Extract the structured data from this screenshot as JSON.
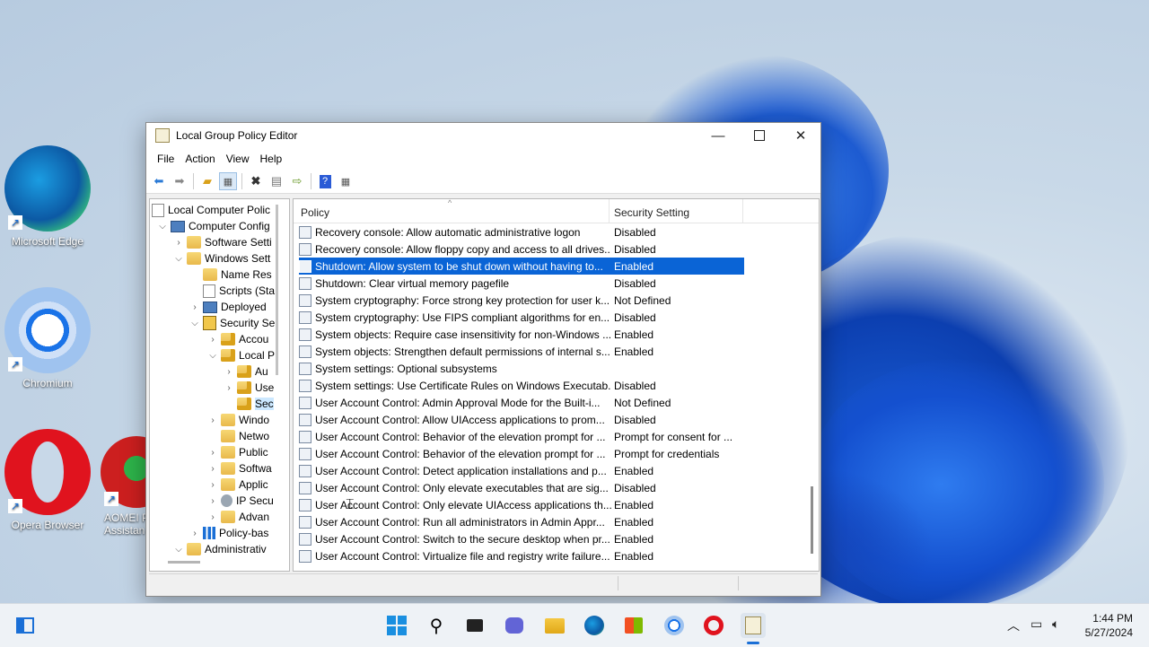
{
  "desktop": {
    "icons": [
      {
        "label": "Microsoft Edge"
      },
      {
        "label": "Chromium"
      },
      {
        "label": "Opera Browser"
      },
      {
        "label": "AOMEI P\nAssistan"
      }
    ]
  },
  "window": {
    "title": "Local Group Policy Editor",
    "menu": [
      "File",
      "Action",
      "View",
      "Help"
    ],
    "tree": [
      {
        "label": "Local Computer Polic",
        "indent": 0,
        "icon": "doc",
        "exp": ""
      },
      {
        "label": "Computer Config",
        "indent": 1,
        "icon": "pc",
        "exp": "v"
      },
      {
        "label": "Software Setti",
        "indent": 2,
        "icon": "folder",
        "exp": ">"
      },
      {
        "label": "Windows Sett",
        "indent": 2,
        "icon": "folder",
        "exp": "v"
      },
      {
        "label": "Name Res",
        "indent": 3,
        "icon": "folder",
        "exp": ""
      },
      {
        "label": "Scripts (Sta",
        "indent": 3,
        "icon": "doc",
        "exp": ""
      },
      {
        "label": "Deployed",
        "indent": 3,
        "icon": "pc",
        "exp": ">"
      },
      {
        "label": "Security Se",
        "indent": 3,
        "icon": "shield",
        "exp": "v"
      },
      {
        "label": "Accou",
        "indent": 4,
        "icon": "lockf",
        "exp": ">"
      },
      {
        "label": "Local P",
        "indent": 4,
        "icon": "lockf",
        "exp": "v"
      },
      {
        "label": "Au",
        "indent": 5,
        "icon": "lockf",
        "exp": ">"
      },
      {
        "label": "Use",
        "indent": 5,
        "icon": "lockf",
        "exp": ">"
      },
      {
        "label": "Sec",
        "indent": 5,
        "icon": "lockf",
        "exp": "",
        "selected": true
      },
      {
        "label": "Windo",
        "indent": 4,
        "icon": "folder",
        "exp": ">"
      },
      {
        "label": "Netwo",
        "indent": 4,
        "icon": "folder",
        "exp": ""
      },
      {
        "label": "Public",
        "indent": 4,
        "icon": "folder",
        "exp": ">"
      },
      {
        "label": "Softwa",
        "indent": 4,
        "icon": "folder",
        "exp": ">"
      },
      {
        "label": "Applic",
        "indent": 4,
        "icon": "folder",
        "exp": ">"
      },
      {
        "label": "IP Secu",
        "indent": 4,
        "icon": "gear",
        "exp": ">"
      },
      {
        "label": "Advan",
        "indent": 4,
        "icon": "folder",
        "exp": ">"
      },
      {
        "label": "Policy-bas",
        "indent": 3,
        "icon": "bars",
        "exp": ">"
      },
      {
        "label": "Administrativ",
        "indent": 2,
        "icon": "folder",
        "exp": "v"
      }
    ],
    "columns": {
      "policy": "Policy",
      "setting": "Security Setting"
    },
    "policies": [
      {
        "name": "Recovery console: Allow automatic administrative logon",
        "setting": "Disabled"
      },
      {
        "name": "Recovery console: Allow floppy copy and access to all drives...",
        "setting": "Disabled"
      },
      {
        "name": "Shutdown: Allow system to be shut down without having to...",
        "setting": "Enabled",
        "selected": true
      },
      {
        "name": "Shutdown: Clear virtual memory pagefile",
        "setting": "Disabled"
      },
      {
        "name": "System cryptography: Force strong key protection for user k...",
        "setting": "Not Defined"
      },
      {
        "name": "System cryptography: Use FIPS compliant algorithms for en...",
        "setting": "Disabled"
      },
      {
        "name": "System objects: Require case insensitivity for non-Windows ...",
        "setting": "Enabled"
      },
      {
        "name": "System objects: Strengthen default permissions of internal s...",
        "setting": "Enabled"
      },
      {
        "name": "System settings: Optional subsystems",
        "setting": ""
      },
      {
        "name": "System settings: Use Certificate Rules on Windows Executab...",
        "setting": "Disabled"
      },
      {
        "name": "User Account Control: Admin Approval Mode for the Built-i...",
        "setting": "Not Defined"
      },
      {
        "name": "User Account Control: Allow UIAccess applications to prom...",
        "setting": "Disabled"
      },
      {
        "name": "User Account Control: Behavior of the elevation prompt for ...",
        "setting": "Prompt for consent for ..."
      },
      {
        "name": "User Account Control: Behavior of the elevation prompt for ...",
        "setting": "Prompt for credentials"
      },
      {
        "name": "User Account Control: Detect application installations and p...",
        "setting": "Enabled"
      },
      {
        "name": "User Account Control: Only elevate executables that are sig...",
        "setting": "Disabled"
      },
      {
        "name": "User Account Control: Only elevate UIAccess applications th...",
        "setting": "Enabled"
      },
      {
        "name": "User Account Control: Run all administrators in Admin Appr...",
        "setting": "Enabled"
      },
      {
        "name": "User Account Control: Switch to the secure desktop when pr...",
        "setting": "Enabled"
      },
      {
        "name": "User Account Control: Virtualize file and registry write failure...",
        "setting": "Enabled"
      }
    ]
  },
  "taskbar": {
    "time": "1:44 PM",
    "date": "5/27/2024"
  }
}
